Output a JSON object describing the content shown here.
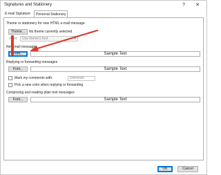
{
  "window": {
    "title": "Signatures and Stationery",
    "help_label": "?",
    "close_label": "✕"
  },
  "tabs": [
    {
      "label": "E-mail Signature",
      "selected": false
    },
    {
      "label": "Personal Stationery",
      "selected": true
    }
  ],
  "theme_section": {
    "heading": "Theme or stationery for new HTML e-mail message",
    "theme_button": "Theme...",
    "theme_value": "No theme currently selected",
    "font_label": "Font:",
    "font_select": "Use theme's font"
  },
  "new_mail": {
    "heading": "New mail messages",
    "font_button": "Font...",
    "sample": "Sample Text"
  },
  "reply_forward": {
    "heading": "Replying or forwarding messages",
    "font_button": "Font...",
    "sample": "Sample Text",
    "mark_comments_label": "Mark my comments with:",
    "mark_comments_value": "Unknown",
    "pick_color_label": "Pick a new color when replying or forwarding"
  },
  "plain_text": {
    "heading": "Composing and reading plain text messages",
    "font_button": "Font...",
    "sample": "Sample Text"
  },
  "footer": {
    "ok": "OK",
    "cancel": "Cancel"
  },
  "colors": {
    "accent": "#0078d7",
    "annotation": "#d93a2f"
  },
  "icons": {
    "help": "help-icon",
    "close": "close-icon",
    "dropdown": "chevron-down-icon",
    "annotation_arrow": "arrow-icon"
  }
}
